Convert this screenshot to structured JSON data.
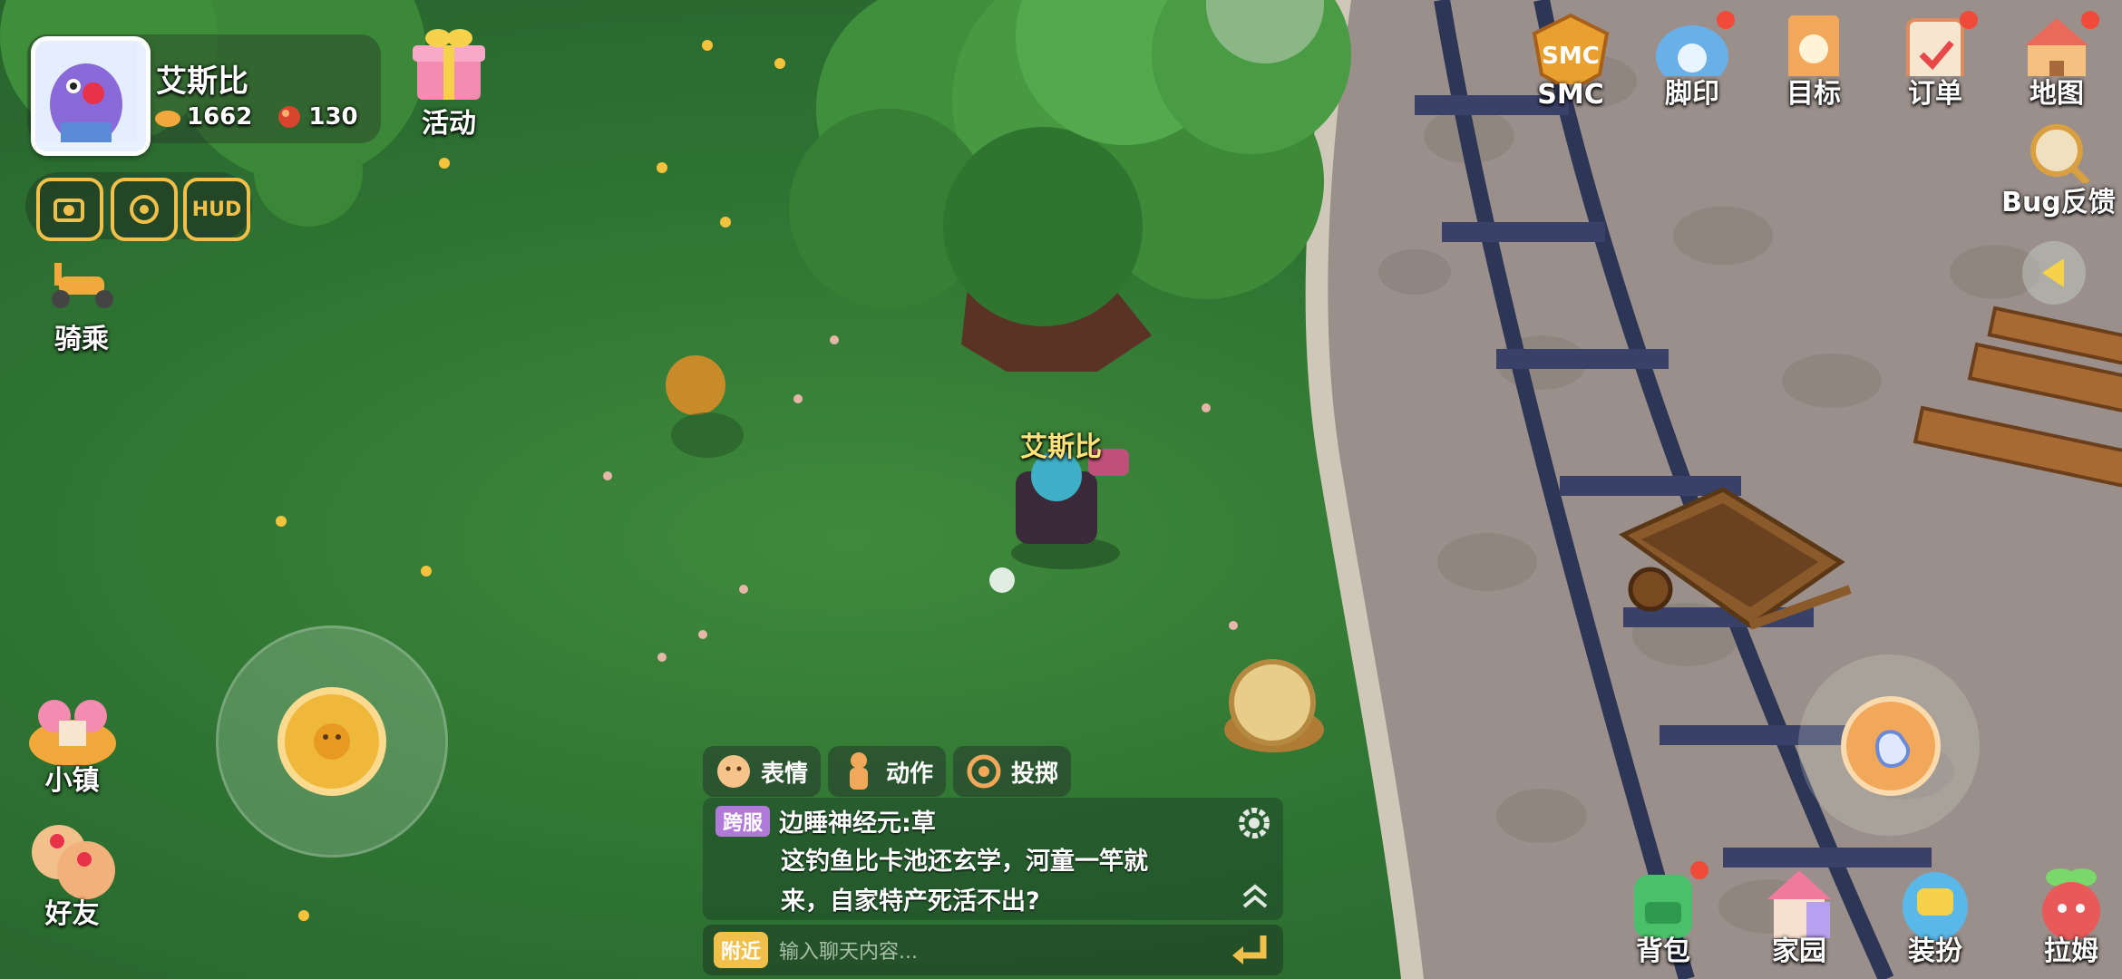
{
  "player": {
    "name": "艾斯比",
    "currency_a": "1662",
    "currency_b": "130"
  },
  "events": {
    "label": "活动"
  },
  "hud_buttons": {
    "camera": "camera-icon",
    "focus": "focus-icon",
    "hud_label": "HUD"
  },
  "ride": {
    "label": "骑乘"
  },
  "top_menu": [
    {
      "label": "SMC",
      "icon": "smc-badge-icon",
      "badge_text": "SMC"
    },
    {
      "label": "脚印",
      "icon": "footprint-icon"
    },
    {
      "label": "目标",
      "icon": "goal-icon"
    },
    {
      "label": "订单",
      "icon": "order-icon"
    },
    {
      "label": "地图",
      "icon": "map-icon"
    }
  ],
  "bug_feedback": {
    "label": "Bug反馈"
  },
  "character_nametag": "艾斯比",
  "left_menu": {
    "town": "小镇",
    "friends": "好友"
  },
  "chat": {
    "tabs": [
      "表情",
      "动作",
      "投掷"
    ],
    "tag": "跨服",
    "message_title": "边睡神经元:草",
    "message_line1": "这钓鱼比卡池还玄学，河童一竿就",
    "message_line2": "来，自家特产死活不出?",
    "channel": "附近",
    "input_placeholder": "输入聊天内容..."
  },
  "bottom_menu": [
    {
      "label": "背包",
      "icon": "backpack-icon"
    },
    {
      "label": "家园",
      "icon": "home-icon"
    },
    {
      "label": "装扮",
      "icon": "outfit-icon"
    },
    {
      "label": "拉姆",
      "icon": "lamu-icon"
    }
  ],
  "colors": {
    "accent_gold": "#f0c04a",
    "notification_red": "#f04a3a",
    "ui_green": "#2f7433"
  }
}
